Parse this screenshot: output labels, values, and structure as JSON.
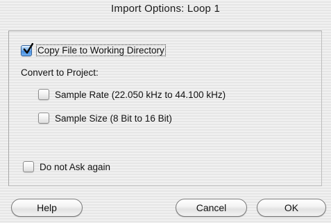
{
  "window": {
    "title": "Import Options: Loop 1"
  },
  "options": {
    "copy_file": {
      "label": "Copy File to Working Directory",
      "checked": true
    },
    "convert_heading": "Convert to Project:",
    "sample_rate": {
      "label": "Sample Rate (22.050 kHz to 44.100 kHz)",
      "checked": false
    },
    "sample_size": {
      "label": "Sample Size (8 Bit to 16 Bit)",
      "checked": false
    },
    "do_not_ask": {
      "label": "Do not Ask again",
      "checked": false
    }
  },
  "buttons": {
    "help": "Help",
    "cancel": "Cancel",
    "ok": "OK"
  },
  "colors": {
    "checkbox_checked": "#3f8ae0",
    "background_stripe_light": "#f1f1f1",
    "background_stripe_dark": "#e6e6e6"
  }
}
